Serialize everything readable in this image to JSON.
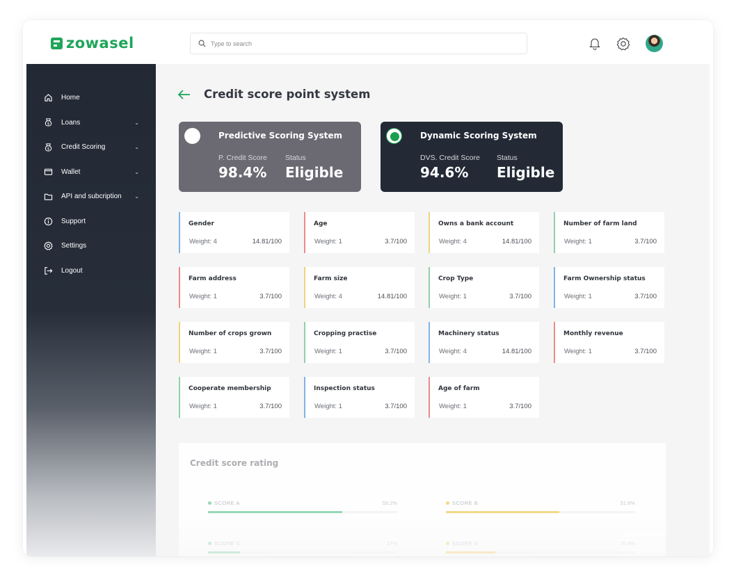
{
  "app": {
    "logo_text": "zowasel",
    "brand_color": "#1fa55b"
  },
  "search": {
    "placeholder": "Type to search"
  },
  "header_icons": [
    "bell-icon",
    "gear-icon",
    "user-avatar"
  ],
  "sidebar": {
    "items": [
      {
        "label": "Home",
        "icon": "home-icon",
        "has_chevron": false
      },
      {
        "label": "Loans",
        "icon": "loans-icon",
        "has_chevron": true
      },
      {
        "label": "Credit Scoring",
        "icon": "credit-scoring-icon",
        "has_chevron": true
      },
      {
        "label": "Wallet",
        "icon": "wallet-icon",
        "has_chevron": true
      },
      {
        "label": "API and subcription",
        "icon": "folder-icon",
        "has_chevron": true
      },
      {
        "label": "Support",
        "icon": "info-icon",
        "has_chevron": false
      },
      {
        "label": "Settings",
        "icon": "settings-icon",
        "has_chevron": false
      },
      {
        "label": "Logout",
        "icon": "logout-icon",
        "has_chevron": false
      }
    ]
  },
  "page": {
    "title": "Credit score point system"
  },
  "systems": [
    {
      "name": "Predictive  Scoring System",
      "score_label": "P. Credit Score",
      "score": "98.4%",
      "status_label": "Status",
      "status": "Eligible",
      "selected": false
    },
    {
      "name": "Dynamic  Scoring System",
      "score_label": "DVS. Credit Score",
      "score": "94.6%",
      "status_label": "Status",
      "status": "Eligible",
      "selected": true
    }
  ],
  "criteria": [
    {
      "name": "Gender",
      "weight": "Weight: 4",
      "score": "14.81/100",
      "color": "#7fb3e6"
    },
    {
      "name": "Age",
      "weight": "Weight: 1",
      "score": "3.7/100",
      "color": "#ec8a8a"
    },
    {
      "name": "Owns a bank account",
      "weight": "Weight: 4",
      "score": "14.81/100",
      "color": "#f1d27d"
    },
    {
      "name": "Number of farm land",
      "weight": "Weight: 1",
      "score": "3.7/100",
      "color": "#8fd0a8"
    },
    {
      "name": "Farm address",
      "weight": "Weight: 1",
      "score": "3.7/100",
      "color": "#ec8a8a"
    },
    {
      "name": "Farm size",
      "weight": "Weight: 4",
      "score": "14.81/100",
      "color": "#f1d27d"
    },
    {
      "name": "Crop Type",
      "weight": "Weight: 1",
      "score": "3.7/100",
      "color": "#8fd0a8"
    },
    {
      "name": "Farm Ownership status",
      "weight": "Weight: 1",
      "score": "3.7/100",
      "color": "#7fb3e6"
    },
    {
      "name": "Number of crops grown",
      "weight": "Weight: 1",
      "score": "3.7/100",
      "color": "#f1d27d"
    },
    {
      "name": "Cropping practise",
      "weight": "Weight: 1",
      "score": "3.7/100",
      "color": "#8fd0a8"
    },
    {
      "name": "Machinery status",
      "weight": "Weight: 4",
      "score": "14.81/100",
      "color": "#7fb3e6"
    },
    {
      "name": "Monthly revenue",
      "weight": "Weight: 1",
      "score": "3.7/100",
      "color": "#ec8a8a"
    },
    {
      "name": "Cooperate membership",
      "weight": "Weight: 1",
      "score": "3.7/100",
      "color": "#8fd0a8"
    },
    {
      "name": "Inspection status",
      "weight": "Weight: 1",
      "score": "3.7/100",
      "color": "#7fb3e6"
    },
    {
      "name": "Age of farm",
      "weight": "Weight: 1",
      "score": "3.7/100",
      "color": "#ec8a8a"
    }
  ],
  "rating": {
    "title": "Credit score rating",
    "scores": [
      {
        "label": "SCORE A",
        "percent": "59.2%",
        "fraction": 0.71,
        "color": "#8fd7b0"
      },
      {
        "label": "SCORE B",
        "percent": "51.8%",
        "fraction": 0.6,
        "color": "#f5d77f"
      },
      {
        "label": "SCORE C",
        "percent": "17%",
        "fraction": 0.17,
        "color": "#8fd7b0"
      },
      {
        "label": "SCORE D",
        "percent": "25.6%",
        "fraction": 0.26,
        "color": "#f5d77f"
      }
    ]
  }
}
